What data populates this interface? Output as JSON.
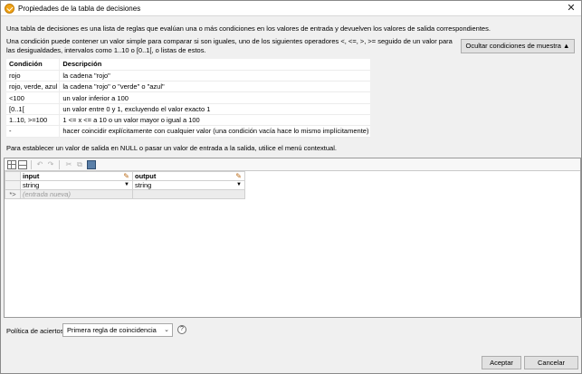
{
  "window": {
    "title": "Propiedades de la tabla de decisiones",
    "close_glyph": "✕"
  },
  "intro": {
    "line1": "Una tabla de decisiones es una lista de reglas que evalúan una o más condiciones en los valores de entrada y devuelven los valores de salida correspondientes.",
    "line2": "Una condición puede contener un valor simple para comparar si son iguales, uno de los siguientes operadores <, <=, >, >= seguido de un valor para las desigualdades, intervalos como 1..10 o [0..1[, o listas de estos."
  },
  "hide_button": {
    "label": "Ocultar condiciones de muestra ▲"
  },
  "conditions_table": {
    "headers": [
      "Condición",
      "Descripción"
    ],
    "rows": [
      [
        "rojo",
        "la cadena \"rojo\""
      ],
      [
        "rojo, verde, azul",
        "la cadena \"rojo\" o \"verde\" o \"azul\""
      ],
      [
        "<100",
        "un valor inferior a 100"
      ],
      [
        "[0..1[",
        "un valor entre 0 y 1, excluyendo el valor exacto 1"
      ],
      [
        "1..10, >=100",
        "1 <= x <= a 10 o un valor mayor o igual a 100"
      ],
      [
        "-",
        "hacer coincidir explícitamente con cualquier valor (una condición vacía hace lo mismo implícitamente)"
      ]
    ]
  },
  "null_note": "Para establecer un valor de salida en NULL o pasar un valor de entrada a la salida, utilice el menú contextual.",
  "toolbar": {
    "icons": [
      "insert-row-icon",
      "insert-column-icon",
      "undo-icon",
      "redo-icon",
      "cut-icon",
      "copy-icon",
      "image-icon"
    ]
  },
  "decision_table": {
    "input_header": "input",
    "output_header": "output",
    "input_type": "string",
    "output_type": "string",
    "new_row_marker": "*>",
    "new_row_placeholder": "(entrada nueva)"
  },
  "policy": {
    "label": "Política de aciertos:",
    "selected": "Primera regla de coincidencia",
    "help_glyph": "?"
  },
  "buttons": {
    "accept": "Aceptar",
    "cancel": "Cancelar"
  },
  "colors": {
    "window_bg": "#f0f0f0",
    "app_icon": "#f2a516",
    "pencil_icon": "#b86a17"
  }
}
